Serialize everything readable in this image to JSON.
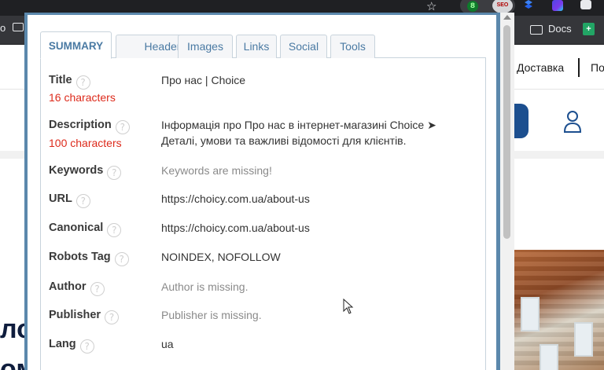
{
  "browser": {
    "bookmarks": {
      "left_partial": "o",
      "docs_label": "Docs",
      "sheets_glyph": "+"
    },
    "extensions": {
      "green_badge": "8",
      "seo_badge": "SEO"
    }
  },
  "website": {
    "nav_delivery": "Доставка",
    "nav_partial": "По",
    "hero_partial_1": "ло",
    "hero_partial_2": "ом"
  },
  "seo_panel": {
    "tabs": [
      {
        "label": "SUMMARY",
        "active": true
      },
      {
        "label": "Headers",
        "active": false
      },
      {
        "label": "Images",
        "active": false
      },
      {
        "label": "Links",
        "active": false
      },
      {
        "label": "Social",
        "active": false
      },
      {
        "label": "Tools",
        "active": false
      }
    ],
    "help_glyph": "?",
    "rows": {
      "title": {
        "label": "Title",
        "note": "16 characters",
        "value": "Про нас | Choice"
      },
      "description": {
        "label": "Description",
        "note": "100 characters",
        "value": "Інформація про Про нас в інтернет-магазині Choice ➤ Деталі, умови та важливі відомості для клієнтів."
      },
      "keywords": {
        "label": "Keywords",
        "value": "Keywords are missing!"
      },
      "url": {
        "label": "URL",
        "value": "https://choicy.com.ua/about-us"
      },
      "canonical": {
        "label": "Canonical",
        "value": "https://choicy.com.ua/about-us"
      },
      "robots": {
        "label": "Robots Tag",
        "value": "NOINDEX, NOFOLLOW"
      },
      "author": {
        "label": "Author",
        "value": "Author is missing."
      },
      "publisher": {
        "label": "Publisher",
        "value": "Publisher is missing."
      },
      "lang": {
        "label": "Lang",
        "value": "ua"
      }
    }
  },
  "colors": {
    "popup_border": "#5b88ac",
    "tab_text": "#4a7aa3",
    "note_red": "#dd2a1b",
    "missing_gray": "#8a8a8a",
    "site_button": "#1c4f8f"
  }
}
